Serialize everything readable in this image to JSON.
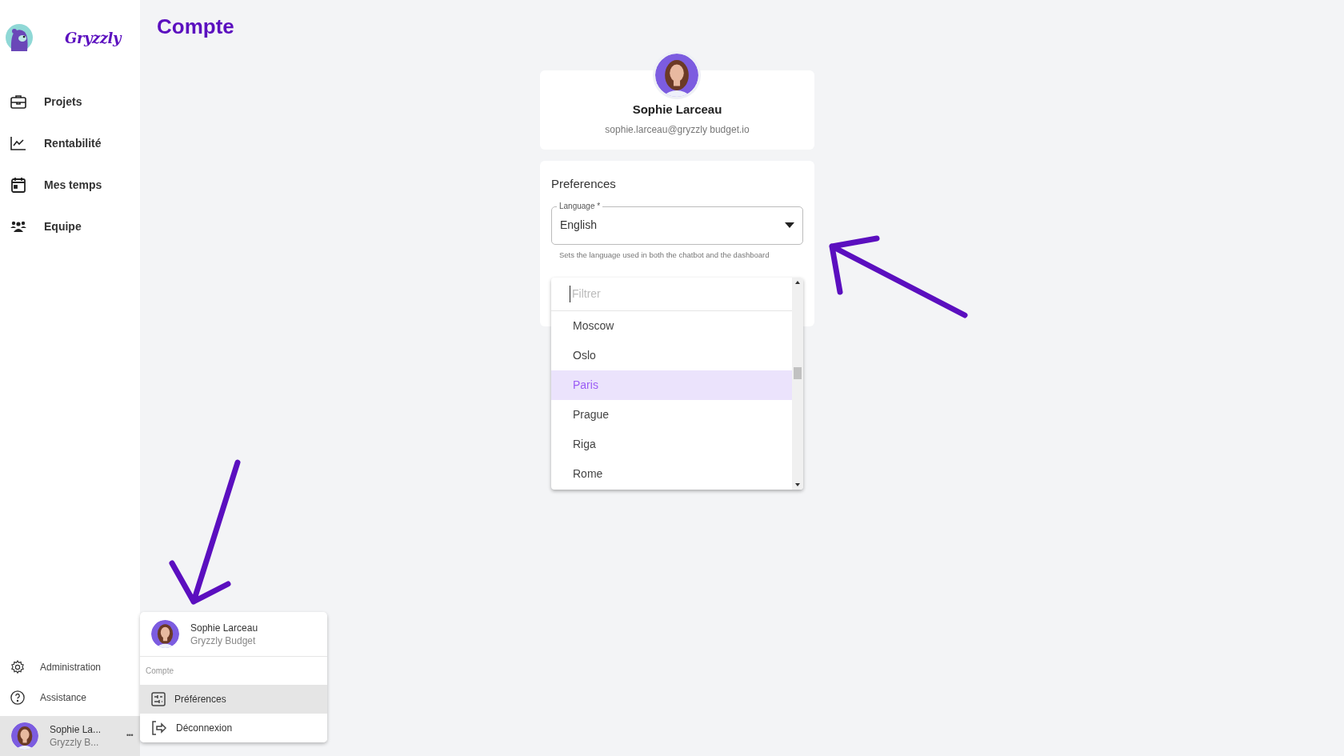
{
  "sidebar": {
    "logo_text": "Gryzzly",
    "nav": [
      {
        "label": "Projets"
      },
      {
        "label": "Rentabilité"
      },
      {
        "label": "Mes temps"
      },
      {
        "label": "Equipe"
      }
    ],
    "bottom": [
      {
        "label": "Administration"
      },
      {
        "label": "Assistance"
      }
    ],
    "user": {
      "name": "Sophie La...",
      "org": "Gryzzly B...",
      "more": "•••",
      "selected": true
    }
  },
  "page_title": "Compte",
  "profile": {
    "name": "Sophie Larceau",
    "email": "sophie.larceau@gryzzly budget.io"
  },
  "preferences": {
    "title": "Preferences",
    "language": {
      "label": "Language *",
      "value": "English",
      "helper": "Sets the language used in both the chatbot and the dashboard"
    },
    "timezone_dropdown": {
      "placeholder": "Filtrer",
      "options": [
        {
          "label": "Moscow",
          "selected": false
        },
        {
          "label": "Oslo",
          "selected": false
        },
        {
          "label": "Paris",
          "selected": true
        },
        {
          "label": "Prague",
          "selected": false
        },
        {
          "label": "Riga",
          "selected": false
        },
        {
          "label": "Rome",
          "selected": false
        }
      ]
    }
  },
  "user_menu": {
    "name": "Sophie Larceau",
    "org": "Gryzzly Budget",
    "section": "Compte",
    "items": [
      {
        "label": "Préférences",
        "selected": true
      },
      {
        "label": "Déconnexion",
        "selected": false
      }
    ]
  }
}
